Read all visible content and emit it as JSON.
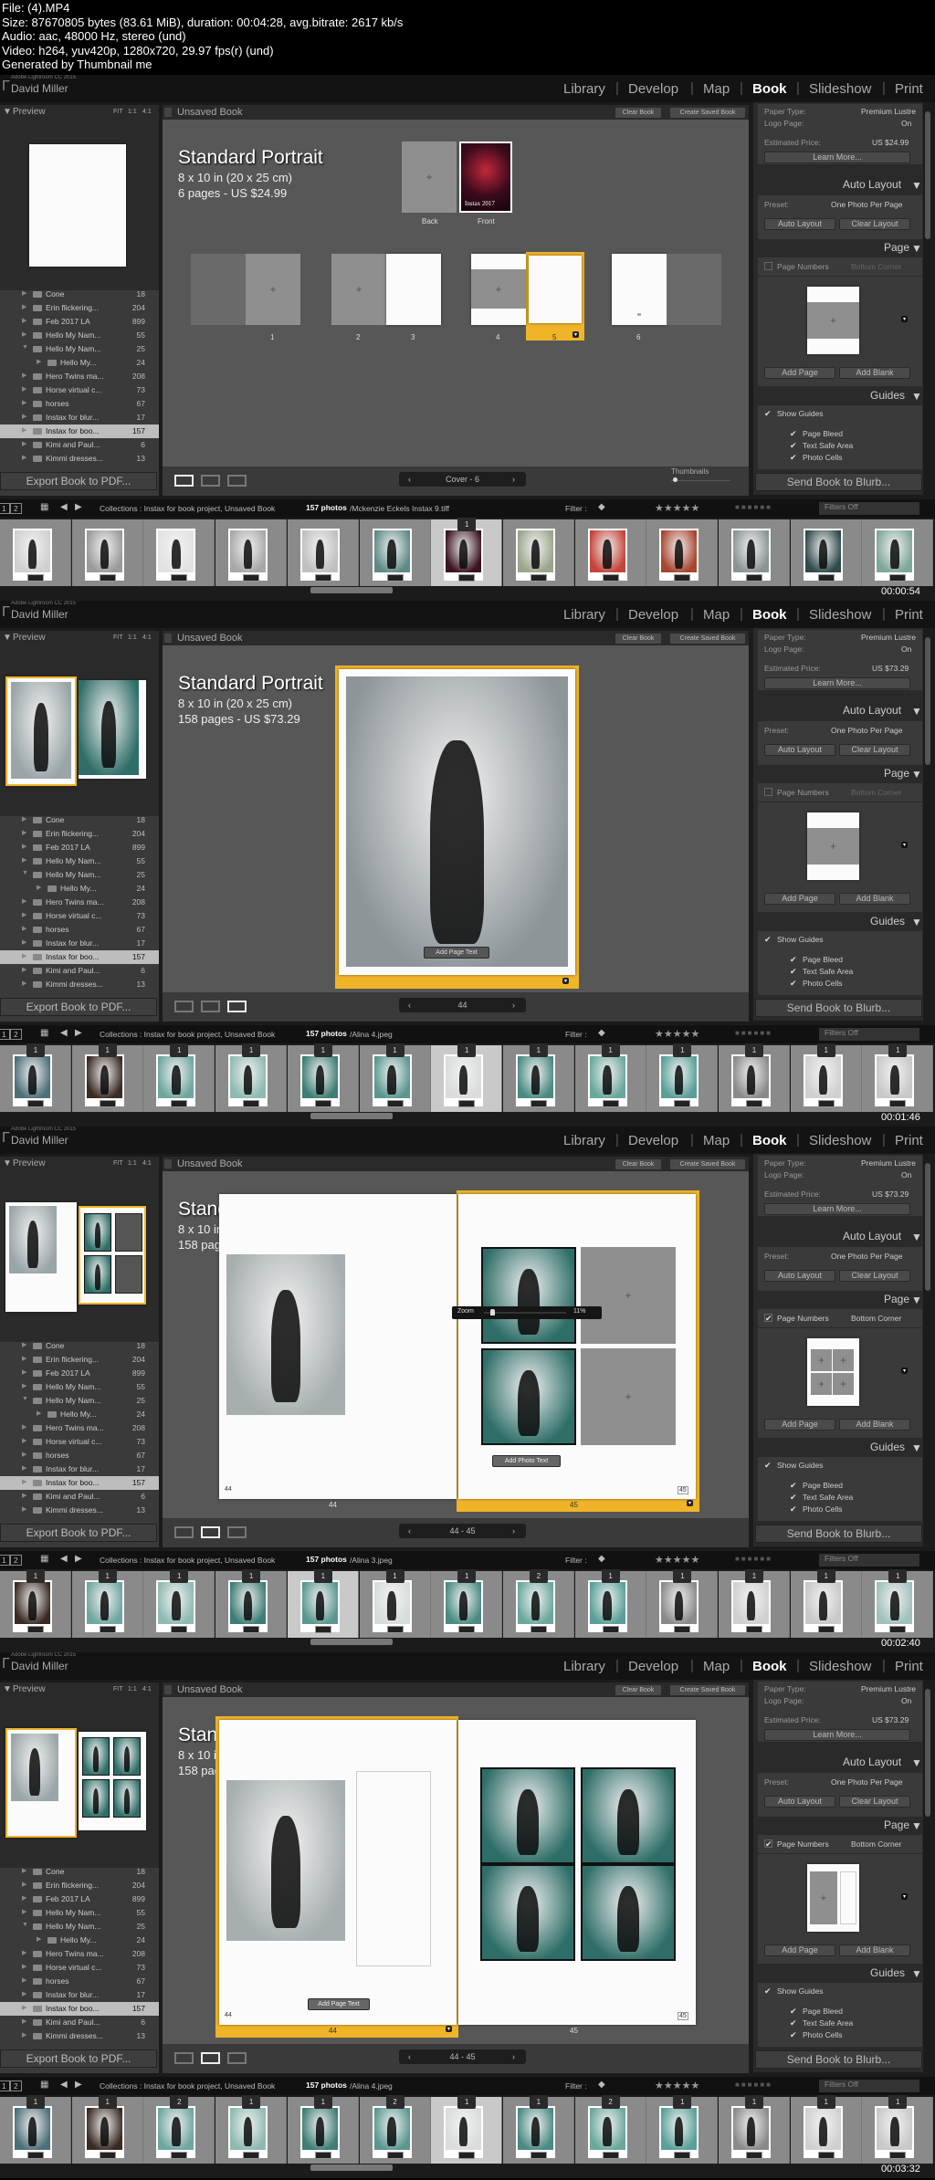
{
  "video_info": [
    "File: (4).MP4",
    "Size: 87670805 bytes (83.61 MiB), duration: 00:04:28, avg.bitrate: 2617 kb/s",
    "Audio: aac, 48000 Hz, stereo (und)",
    "Video: h264, yuv420p, 1280x720, 29.97 fps(r) (und)",
    "Generated by Thumbnail me"
  ],
  "shared": {
    "identity_small": "Adobe Lightroom CC 2015",
    "identity_name": "David Miller",
    "modules": [
      "Library",
      "Develop",
      "Map",
      "Book",
      "Slideshow",
      "Print"
    ],
    "active_module": "Book",
    "left": {
      "preview_label": "Preview",
      "zoom_options": [
        "FIT",
        "1:1",
        "4:1"
      ],
      "export_button": "Export Book to PDF...",
      "collections": [
        {
          "name": "Cone",
          "count": "18"
        },
        {
          "name": "Erin flickering...",
          "count": "204"
        },
        {
          "name": "Feb 2017 LA",
          "count": "899"
        },
        {
          "name": "Hello My Nam...",
          "count": "55"
        },
        {
          "name": "Hello My Nam...",
          "count": "25",
          "expanded": true
        },
        {
          "name": "Hello My...",
          "count": "24",
          "child": true
        },
        {
          "name": "Hero Twins ma...",
          "count": "208"
        },
        {
          "name": "Horse virtual c...",
          "count": "73"
        },
        {
          "name": "horses",
          "count": "67"
        },
        {
          "name": "Instax for blur...",
          "count": "17"
        },
        {
          "name": "Instax for boo...",
          "count": "157",
          "selected": true
        },
        {
          "name": "Kimi and Paul...",
          "count": "6"
        },
        {
          "name": "Kimmi dresses...",
          "count": "13"
        }
      ]
    },
    "center": {
      "title": "Unsaved Book",
      "clear_book": "Clear Book",
      "create_saved_book": "Create Saved Book"
    },
    "book": {
      "title": "Standard Portrait",
      "size": "8 x 10 in (20 x 25 cm)"
    },
    "right": {
      "paper_type_label": "Paper Type:",
      "paper_type": "Premium Lustre",
      "logo_page_label": "Logo Page:",
      "logo_page": "On",
      "estimated_price_label": "Estimated Price:",
      "learn_more": "Learn More...",
      "auto_layout_header": "Auto Layout",
      "preset_label": "Preset:",
      "preset": "One Photo Per Page",
      "auto_layout_button": "Auto Layout",
      "clear_layout_button": "Clear Layout",
      "page_header": "Page",
      "page_numbers_label": "Page Numbers",
      "page_numbers_position": "Bottom Corner",
      "add_page": "Add Page",
      "add_blank": "Add Blank",
      "guides_header": "Guides",
      "show_guides": "Show Guides",
      "guides": [
        "Page Bleed",
        "Text Safe Area",
        "Photo Cells"
      ],
      "send_to_blurb": "Send Book to Blurb..."
    },
    "filmstrip": {
      "pages": [
        "1",
        "2"
      ],
      "source": "Collections : Instax for book project, Unsaved Book",
      "count": "157 photos",
      "filter_label": "Filter :",
      "filters": "Filters Off"
    },
    "colors": {
      "accent": "#f0b429",
      "panel": "#3a3a3a",
      "canvas": "#575757",
      "background": "#1b1b1b"
    }
  },
  "frames": [
    {
      "timestamp": "00:00:54",
      "view": "multi-page",
      "pages_price": "6 pages - US $24.99",
      "estimated_price": "US $24.99",
      "nav": "Cover - 6",
      "file": "/Mckenzie Eckels Instax 9.tiff",
      "page_numbers_checked": false,
      "thumbnails_label": "Thumbnails",
      "covers": [
        "Back",
        "Front"
      ],
      "cover_text": "Instax 2017",
      "page_labels": [
        "1",
        "2",
        "3",
        "4",
        "5",
        "6"
      ],
      "selected_page": "5",
      "filmstrip": {
        "badges": [
          "",
          "",
          "",
          "",
          "",
          "",
          "1",
          "",
          "",
          "",
          "",
          "",
          ""
        ],
        "selected": 6,
        "colors": [
          "#d0d0d0",
          "#9a9a9a",
          "#e2e2e2",
          "#a8a8a8",
          "#c0c0c0",
          "#5f8a86",
          "#3a1420",
          "#9aa58c",
          "#c4443a",
          "#a9452f",
          "#8a9494",
          "#2f4a4a",
          "#7fa69a"
        ]
      }
    },
    {
      "timestamp": "00:01:46",
      "view": "single-page",
      "pages_price": "158 pages - US $73.29",
      "estimated_price": "US $73.29",
      "nav": "44",
      "file": "/Alina 4.jpeg",
      "page_numbers_checked": false,
      "add_page_text": "Add Page Text",
      "filmstrip": {
        "badges": [
          "1",
          "1",
          "1",
          "1",
          "1",
          "1",
          "1",
          "1",
          "1",
          "1",
          "1",
          "1",
          "1"
        ],
        "selected": 6,
        "colors": [
          "#4d6f78",
          "#3a2a24",
          "#6fa6a0",
          "#8fbab2",
          "#3f7d75",
          "#5a9790",
          "#d8dcdc",
          "#4a8a82",
          "#6aa79d",
          "#5a9f98",
          "#8a8a8a",
          "#d0d0d0",
          "#c8c8c8"
        ]
      }
    },
    {
      "timestamp": "00:02:40",
      "view": "spread",
      "pages_price": "158 pages - US $73.29",
      "estimated_price": "US $73.29",
      "nav": "44 - 45",
      "file": "/Alina 3.jpeg",
      "page_numbers_checked": true,
      "left_page": "44",
      "right_page": "45",
      "selected_side": "right",
      "zoom_label": "Zoom",
      "zoom_value": "11%",
      "add_photo_text": "Add Photo Text",
      "filmstrip": {
        "badges": [
          "1",
          "1",
          "1",
          "1",
          "1",
          "1",
          "1",
          "2",
          "1",
          "1",
          "1",
          "1",
          "1"
        ],
        "selected": 4,
        "colors": [
          "#3a2a24",
          "#6fa6a0",
          "#8fbab2",
          "#3f7d75",
          "#5a9790",
          "#d8dcdc",
          "#4a8a82",
          "#6aa79d",
          "#5a9f98",
          "#8a8a8a",
          "#d0d0d0",
          "#c8c8c8",
          "#9fc0bb"
        ]
      }
    },
    {
      "timestamp": "00:03:32",
      "view": "spread",
      "pages_price": "158 pages - US $73.29",
      "estimated_price": "US $73.29",
      "nav": "44 - 45",
      "file": "/Alina 4.jpeg",
      "page_numbers_checked": true,
      "left_page": "44",
      "right_page": "45",
      "selected_side": "left",
      "add_page_text": "Add Page Text",
      "filmstrip": {
        "badges": [
          "1",
          "1",
          "2",
          "1",
          "1",
          "2",
          "1",
          "1",
          "2",
          "1",
          "1",
          "1",
          "1"
        ],
        "selected": 6,
        "colors": [
          "#4d6f78",
          "#3a2a24",
          "#6fa6a0",
          "#8fbab2",
          "#3f7d75",
          "#5a9790",
          "#d8dcdc",
          "#4a8a82",
          "#6aa79d",
          "#5a9f98",
          "#8a8a8a",
          "#d0d0d0",
          "#c8c8c8"
        ]
      }
    }
  ]
}
